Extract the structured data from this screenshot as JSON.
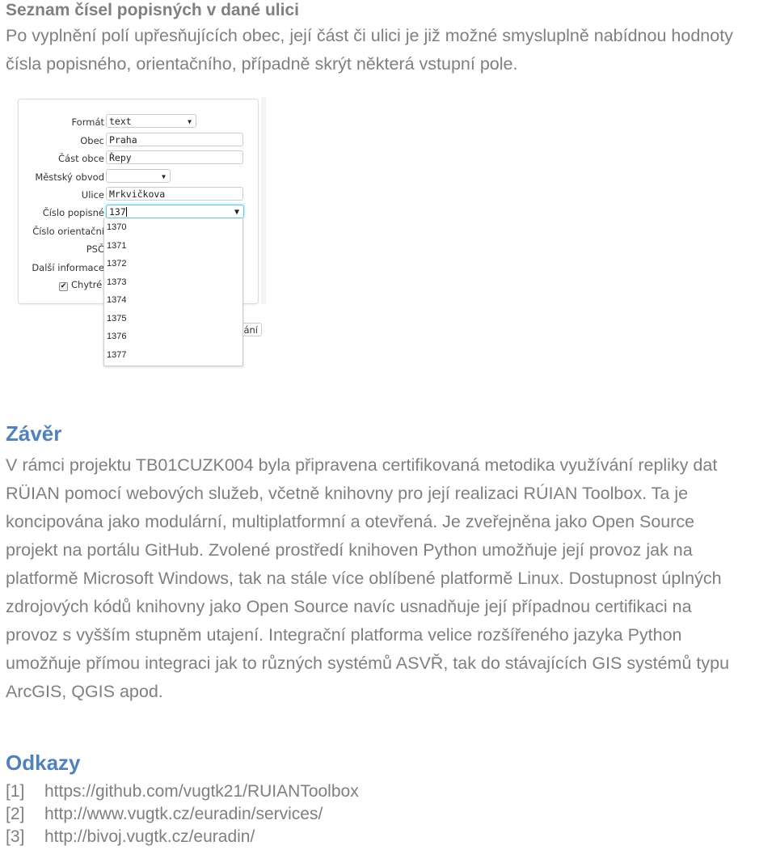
{
  "section": {
    "title": "Seznam čísel popisných v dané ulici",
    "intro_lines": [
      "Po vyplnění polí upřesňujících obec, její část či ulici je již možné smysluplně nabídnou hodnoty",
      "čísla popisného, orientačního, případně skrýt některá vstupní pole."
    ]
  },
  "form": {
    "fields": [
      {
        "label": "Formát",
        "value": "text",
        "type": "select"
      },
      {
        "label": "Obec",
        "value": "Praha",
        "type": "text"
      },
      {
        "label": "Část obce",
        "value": "Řepy",
        "type": "text"
      },
      {
        "label": "Městský obvod",
        "value": "",
        "type": "select"
      },
      {
        "label": "Ulice",
        "value": "Mrkvičkova",
        "type": "text"
      },
      {
        "label": "Číslo popisné",
        "value": "137",
        "type": "combobox"
      },
      {
        "label": "Číslo orientační",
        "value": "",
        "type": "text"
      },
      {
        "label": "PSČ",
        "value": "",
        "type": "text"
      },
      {
        "label": "Další informace",
        "value": "",
        "type": "text"
      }
    ],
    "checkbox": {
      "label": "Chytré r",
      "checked": true,
      "check_glyph": "✔"
    },
    "arrow_glyph": "▼",
    "dropdown_options": [
      "1370",
      "1371",
      "1372",
      "1373",
      "1374",
      "1375",
      "1376",
      "1377"
    ],
    "partial_button_label": "ání"
  },
  "conclusion": {
    "heading": "Závěr",
    "lines": [
      "V rámci projektu TB01CUZK004 byla připravena certifikovaná metodika využívání repliky dat",
      "RÜIAN pomocí webových služeb, včetně knihovny pro její realizaci RÚIAN Toolbox. Ta je",
      "koncipována jako modulární, multiplatformní a otevřená. Je zveřejněna jako Open Source",
      "projekt na portálu GitHub. Zvolené prostředí knihoven Python umožňuje její provoz jak na",
      "platformě Microsoft Windows, tak na stále více oblíbené platformě Linux. Dostupnost úplných",
      "zdrojových kódů knihovny jako Open Source navíc usnadňuje její případnou certifikaci na",
      "provoz s vyšším stupněm utajení. Integrační platforma velice rozšířeného jazyka Python",
      "umožňuje přímou integraci jak to různých systémů ASVŘ, tak do stávajících GIS systémů typu",
      "ArcGIS, QGIS apod."
    ]
  },
  "references": {
    "heading": "Odkazy",
    "items": [
      {
        "num": "[1]",
        "url": "https://github.com/vugtk21/RUIANToolbox"
      },
      {
        "num": "[2]",
        "url": "http://www.vugtk.cz/euradin/services/"
      },
      {
        "num": "[3]",
        "url": "http://bivoj.vugtk.cz/euradin/"
      }
    ]
  },
  "colors": {
    "heading_blue": "#4f81bd",
    "body_gray": "#7f7f7f"
  }
}
